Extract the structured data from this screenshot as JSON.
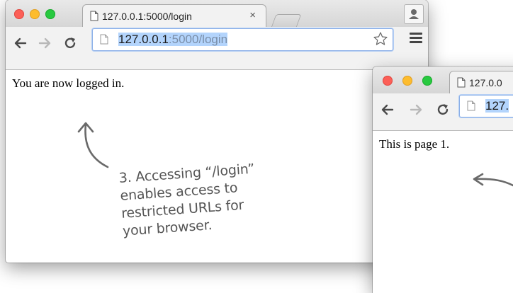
{
  "window_main": {
    "tab_title": "127.0.0.1:5000/login",
    "tab_close": "×",
    "address": {
      "host": "127.0.0.1",
      "rest": ":5000/login"
    },
    "page_text": "You are now logged in."
  },
  "window_secondary": {
    "tab_title": "127.0.0",
    "address": {
      "host": "127."
    },
    "page_text": "This is page 1."
  },
  "annotation": {
    "lines": [
      "3. Accessing “/login”",
      "enables access to",
      "restricted URLs for",
      "your browser."
    ]
  },
  "colors": {
    "close": "#fc5f57",
    "minimize": "#fdbc2e",
    "zoom": "#28c940",
    "url_selection": "#b3d4fc",
    "annotation": "#555555"
  },
  "icons": [
    "document-icon",
    "back-arrow-icon",
    "forward-arrow-icon",
    "reload-icon",
    "bookmark-star-icon",
    "menu-icon",
    "profile-icon"
  ]
}
